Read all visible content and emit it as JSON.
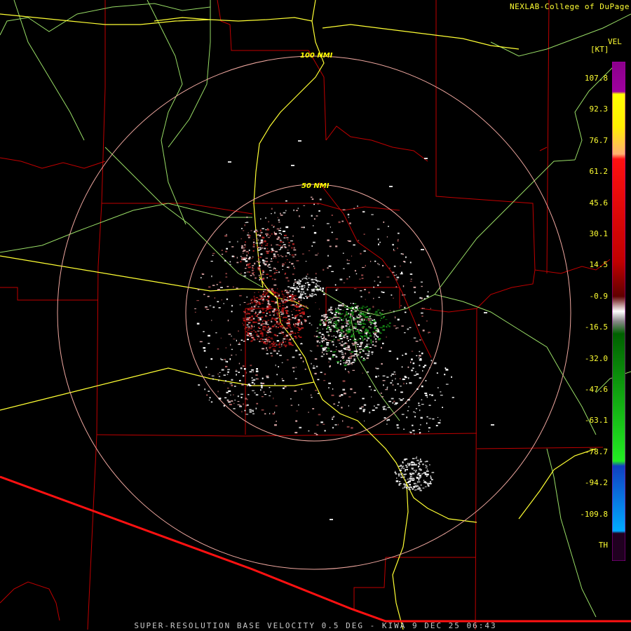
{
  "credit": "NEXLAB-College of DuPage",
  "footer": "SUPER-RESOLUTION BASE VELOCITY 0.5 DEG - KIWA 9 DEC 25 06:43",
  "legend": {
    "product": "VEL",
    "unit": "[KT]",
    "ticks": [
      "107.8",
      "92.3",
      "76.7",
      "61.2",
      "45.6",
      "30.1",
      "14.5",
      "-0.9",
      "-16.5",
      "-32.0",
      "-47.6",
      "-63.1",
      "-78.7",
      "-94.2",
      "-109.8",
      "TH"
    ]
  },
  "rings": {
    "inner_label": "50 NMI",
    "outer_label": "100 NMI"
  },
  "colors": {
    "state_border": "#cc1111",
    "county_border": "#c00000",
    "highway": "#ffff33",
    "minor_road": "#99dd66",
    "range_ring": "#f0a8a0",
    "intl_border": "#ff1111"
  }
}
